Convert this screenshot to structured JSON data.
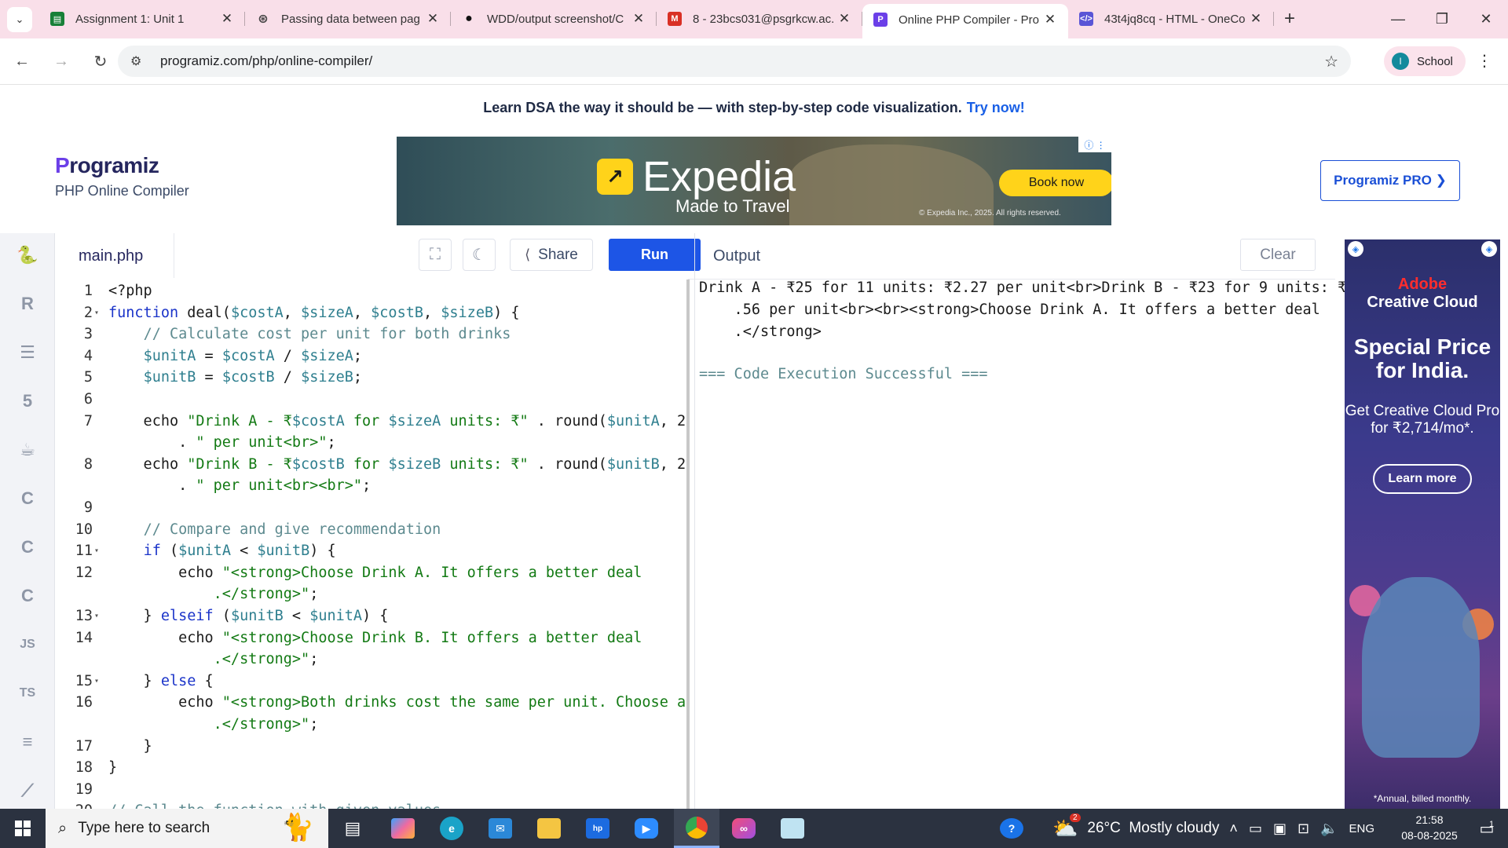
{
  "browser": {
    "tabs": [
      {
        "title": "Assignment 1: Unit 1",
        "color": "#188038",
        "glyph": "▤"
      },
      {
        "title": "Passing data between pag",
        "color": "#444",
        "glyph": "⊛"
      },
      {
        "title": "WDD/output screenshot/C",
        "color": "#111",
        "glyph": "●"
      },
      {
        "title": "8 - 23bcs031@psgrkcw.ac.",
        "color": "#d93025",
        "glyph": "M"
      },
      {
        "title": "Online PHP Compiler - Pro",
        "color": "#6b3fe8",
        "glyph": "P",
        "active": true
      },
      {
        "title": "43t4jq8cq - HTML - OneCo",
        "color": "#5a55d6",
        "glyph": "</>"
      }
    ],
    "url": "programiz.com/php/online-compiler/",
    "profile_initial": "I",
    "profile_label": "School"
  },
  "promo": {
    "text": "Learn DSA the way it should be — with step-by-step code visualization.",
    "link": "Try now!"
  },
  "brand": {
    "logo": "rogramiz",
    "logo_p": "P",
    "subtitle": "PHP Online Compiler",
    "pro_button": "Programiz PRO ❯"
  },
  "ad_top": {
    "brand": "Expedia",
    "tagline": "Made to Travel",
    "cta": "Book now",
    "copyright": "© Expedia Inc., 2025. All rights reserved."
  },
  "editor": {
    "filename": "main.php",
    "share_label": "Share",
    "run_label": "Run",
    "lines": [
      {
        "n": "1",
        "fold": false,
        "html": "&lt;?php"
      },
      {
        "n": "2",
        "fold": true,
        "html": "<span class='kw'>function</span> deal(<span class='vr'>$costA</span>, <span class='vr'>$sizeA</span>, <span class='vr'>$costB</span>, <span class='vr'>$sizeB</span>) {"
      },
      {
        "n": "3",
        "fold": false,
        "html": "    <span class='cm'>// Calculate cost per unit for both drinks</span>"
      },
      {
        "n": "4",
        "fold": false,
        "html": "    <span class='vr'>$unitA</span> = <span class='vr'>$costA</span> / <span class='vr'>$sizeA</span>;"
      },
      {
        "n": "5",
        "fold": false,
        "html": "    <span class='vr'>$unitB</span> = <span class='vr'>$costB</span> / <span class='vr'>$sizeB</span>;"
      },
      {
        "n": "6",
        "fold": false,
        "html": ""
      },
      {
        "n": "7",
        "fold": false,
        "html": "    echo <span class='st'>\"Drink A - ₹</span><span class='vr'>$costA</span><span class='st'> for </span><span class='vr'>$sizeA</span><span class='st'> units: ₹\"</span> . round(<span class='vr'>$unitA</span>, 2)"
      },
      {
        "n": "",
        "fold": false,
        "html": "        . <span class='st'>\" per unit&lt;br&gt;\"</span>;"
      },
      {
        "n": "8",
        "fold": false,
        "html": "    echo <span class='st'>\"Drink B - ₹</span><span class='vr'>$costB</span><span class='st'> for </span><span class='vr'>$sizeB</span><span class='st'> units: ₹\"</span> . round(<span class='vr'>$unitB</span>, 2)"
      },
      {
        "n": "",
        "fold": false,
        "html": "        . <span class='st'>\" per unit&lt;br&gt;&lt;br&gt;\"</span>;"
      },
      {
        "n": "9",
        "fold": false,
        "html": ""
      },
      {
        "n": "10",
        "fold": false,
        "html": "    <span class='cm'>// Compare and give recommendation</span>"
      },
      {
        "n": "11",
        "fold": true,
        "html": "    <span class='kw'>if</span> (<span class='vr'>$unitA</span> &lt; <span class='vr'>$unitB</span>) {"
      },
      {
        "n": "12",
        "fold": false,
        "html": "        echo <span class='st'>\"&lt;strong&gt;Choose Drink A. It offers a better deal</span>"
      },
      {
        "n": "",
        "fold": false,
        "html": "            <span class='st'>.&lt;/strong&gt;\"</span>;"
      },
      {
        "n": "13",
        "fold": true,
        "html": "    } <span class='kw'>elseif</span> (<span class='vr'>$unitB</span> &lt; <span class='vr'>$unitA</span>) {"
      },
      {
        "n": "14",
        "fold": false,
        "html": "        echo <span class='st'>\"&lt;strong&gt;Choose Drink B. It offers a better deal</span>"
      },
      {
        "n": "",
        "fold": false,
        "html": "            <span class='st'>.&lt;/strong&gt;\"</span>;"
      },
      {
        "n": "15",
        "fold": true,
        "html": "    } <span class='kw'>else</span> {"
      },
      {
        "n": "16",
        "fold": false,
        "html": "        echo <span class='st'>\"&lt;strong&gt;Both drinks cost the same per unit. Choose any</span>"
      },
      {
        "n": "",
        "fold": false,
        "html": "            <span class='st'>.&lt;/strong&gt;\"</span>;"
      },
      {
        "n": "17",
        "fold": false,
        "html": "    }"
      },
      {
        "n": "18",
        "fold": false,
        "html": "}"
      },
      {
        "n": "19",
        "fold": false,
        "html": ""
      },
      {
        "n": "20",
        "fold": false,
        "html": "<span class='cm'>// Call the function with given values</span>"
      }
    ]
  },
  "output": {
    "title": "Output",
    "clear_label": "Clear",
    "lines": [
      "Drink A - ₹25 for 11 units: ₹2.27 per unit<br>Drink B - ₹23 for 9 units: ₹2",
      "    .56 per unit<br><br><strong>Choose Drink A. It offers a better deal",
      "    .</strong>"
    ],
    "status": "=== Code Execution Successful ==="
  },
  "sidebar_icons": [
    "python-icon",
    "r-icon",
    "database-icon",
    "html5-icon",
    "java-icon",
    "c-icon",
    "cpp-icon",
    "csharp-icon",
    "js-icon",
    "ts-icon",
    "go-icon",
    "swift-icon"
  ],
  "sidebar_labels": {
    "js": "JS",
    "ts": "TS"
  },
  "ad_right": {
    "brand_line1": "Adobe",
    "brand_line2": "Creative Cloud",
    "headline": "Special Price for India.",
    "body": "Get Creative Cloud Pro for ₹2,714/mo*.",
    "cta": "Learn more",
    "fine": "*Annual, billed monthly."
  },
  "taskbar": {
    "search_placeholder": "Type here to search",
    "weather": "26°C  Mostly cloudy",
    "weather_badge": "2",
    "lang": "ENG",
    "time": "21:58",
    "date": "08-08-2025",
    "notif_count": "1"
  }
}
